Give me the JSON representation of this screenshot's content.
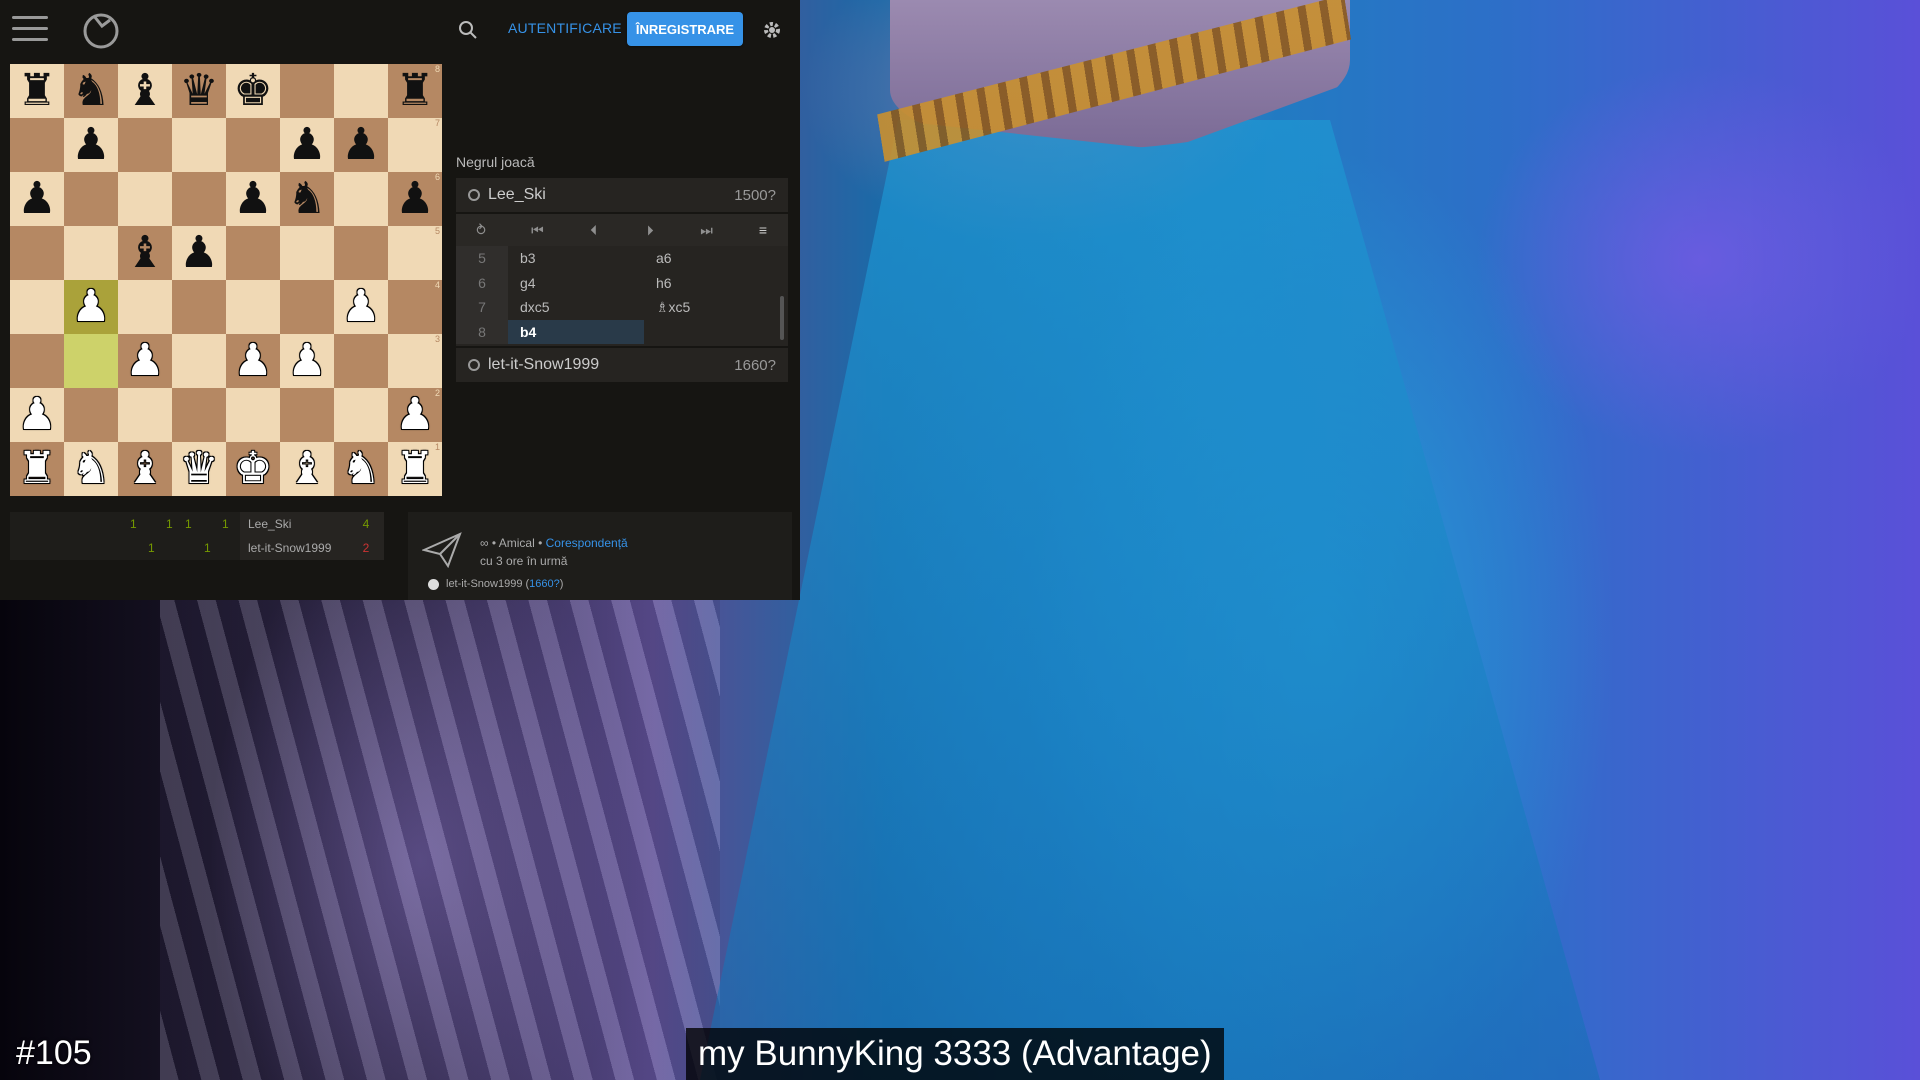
{
  "header": {
    "login_label": "AUTENTIFICARE",
    "register_label": "ÎNREGISTRARE",
    "icons": [
      "hamburger-icon",
      "lichess-logo-icon",
      "search-icon",
      "gear-icon"
    ],
    "accent_color": "#3692e7"
  },
  "board": {
    "ranks": [
      [
        "r",
        "n",
        "b",
        "q",
        "k",
        "",
        "",
        "r"
      ],
      [
        "",
        "p",
        "",
        "",
        "",
        "p",
        "p",
        ""
      ],
      [
        "p",
        "",
        "",
        "",
        "p",
        "n",
        "",
        "p"
      ],
      [
        "",
        "",
        "b",
        "p",
        "",
        "",
        "",
        ""
      ],
      [
        "",
        "P",
        "",
        "",
        "",
        "",
        "P",
        ""
      ],
      [
        "",
        "",
        "P",
        "",
        "P",
        "P",
        "",
        ""
      ],
      [
        "P",
        "",
        "",
        "",
        "",
        "",
        "",
        "P"
      ],
      [
        "R",
        "N",
        "B",
        "Q",
        "K",
        "B",
        "N",
        "R"
      ]
    ],
    "highlight_squares": [
      "b4",
      "b3"
    ],
    "rank_labels": [
      "8",
      "7",
      "6",
      "5",
      "4",
      "3",
      "2",
      "1"
    ],
    "light_color": "#f0d9b5",
    "dark_color": "#b58863"
  },
  "game": {
    "turn_label": "Negrul joacă",
    "top_player": {
      "name": "Lee_Ski",
      "rating": "1500?"
    },
    "bottom_player": {
      "name": "let-it-Snow1999",
      "rating": "1660?"
    },
    "controls": [
      "⥁",
      "⏮",
      "⏴",
      "⏵",
      "⏭",
      "≡"
    ],
    "moves": [
      {
        "num": "5",
        "white": "b3",
        "black": "a6"
      },
      {
        "num": "6",
        "white": "g4",
        "black": "h6"
      },
      {
        "num": "7",
        "white": "dxc5",
        "black": "♗xc5"
      },
      {
        "num": "8",
        "white": "b4",
        "black": ""
      }
    ]
  },
  "crosstable": {
    "rows": [
      {
        "scores": [
          "1",
          "1",
          "1",
          "1"
        ],
        "name": "Lee_Ski",
        "total": "4",
        "total_color": "#759900"
      },
      {
        "scores": [
          "1",
          "1"
        ],
        "name": "let-it-Snow1999",
        "total": "2",
        "total_color": "#cc3333"
      }
    ]
  },
  "game_info": {
    "type_prefix": "∞ • Amical • ",
    "type_link": "Corespondență",
    "time_ago": "cu 3 ore în urmă",
    "player_name": "let-it-Snow1999",
    "player_rating": "1660?"
  },
  "overlay": {
    "episode": "#105",
    "caption": "my BunnyKing 3333 (Advantage)"
  }
}
